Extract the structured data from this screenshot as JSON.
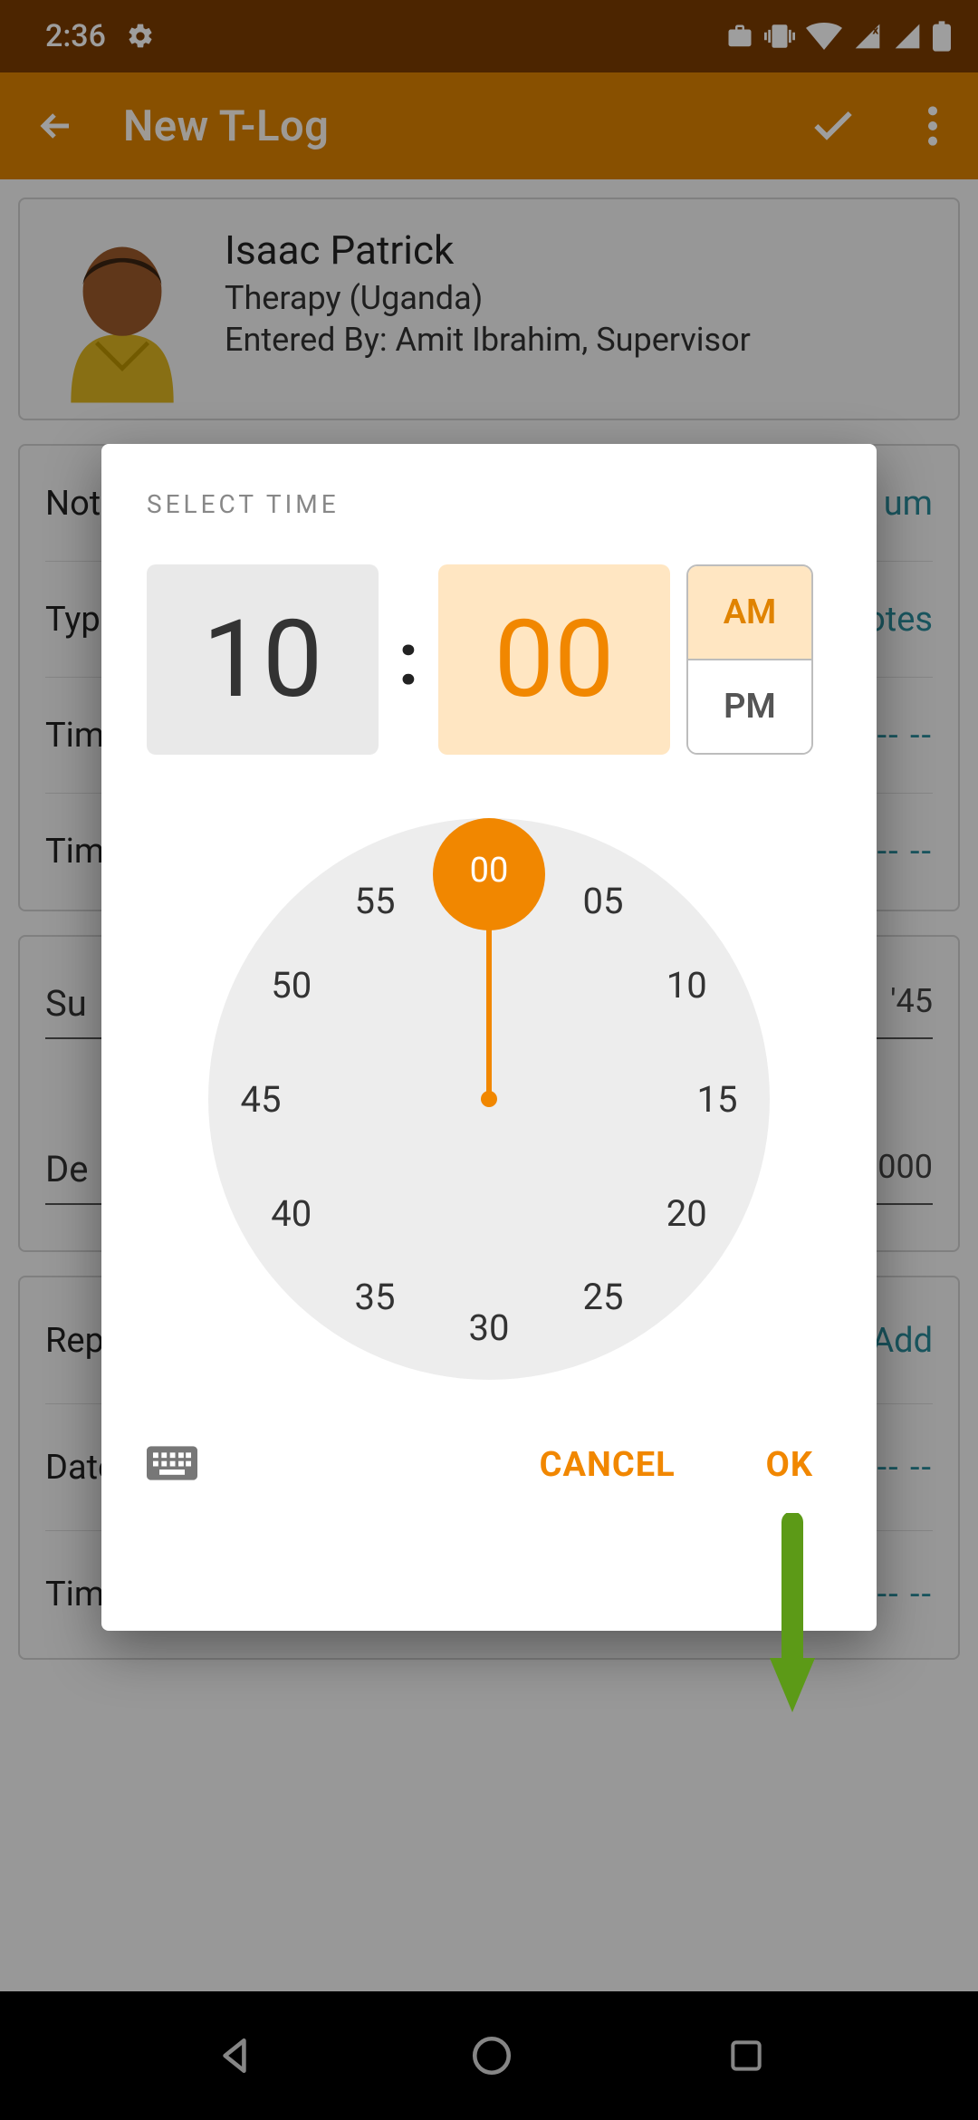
{
  "status": {
    "time": "2:36"
  },
  "appbar": {
    "title": "New T-Log"
  },
  "person": {
    "name": "Isaac Patrick",
    "org": "Therapy (Uganda)",
    "by": "Entered By: Amit Ibrahim, Supervisor"
  },
  "fields1": {
    "r1": {
      "label": "Not",
      "val": "um"
    },
    "r2": {
      "label": "Typ",
      "val": "otes"
    },
    "r3": {
      "label": "Tim",
      "val": "-- --"
    },
    "r4": {
      "label": "Tim",
      "val": "-- --"
    }
  },
  "textcard": {
    "row1l": "Su",
    "row1r": "'45",
    "row2l": "De",
    "row2r": "000"
  },
  "section3": {
    "r1": {
      "label": "Reporter",
      "val": "Add"
    },
    "r2": {
      "label": "Date",
      "val": "-- --"
    },
    "r3": {
      "label": "Time",
      "val": "-- --"
    }
  },
  "dialog": {
    "title": "SELECT TIME",
    "hour": "10",
    "minute": "00",
    "am": "AM",
    "pm": "PM",
    "cancel": "CANCEL",
    "ok": "OK",
    "selected": "00",
    "ticks": [
      "00",
      "05",
      "10",
      "15",
      "20",
      "25",
      "30",
      "35",
      "40",
      "45",
      "50",
      "55"
    ]
  }
}
